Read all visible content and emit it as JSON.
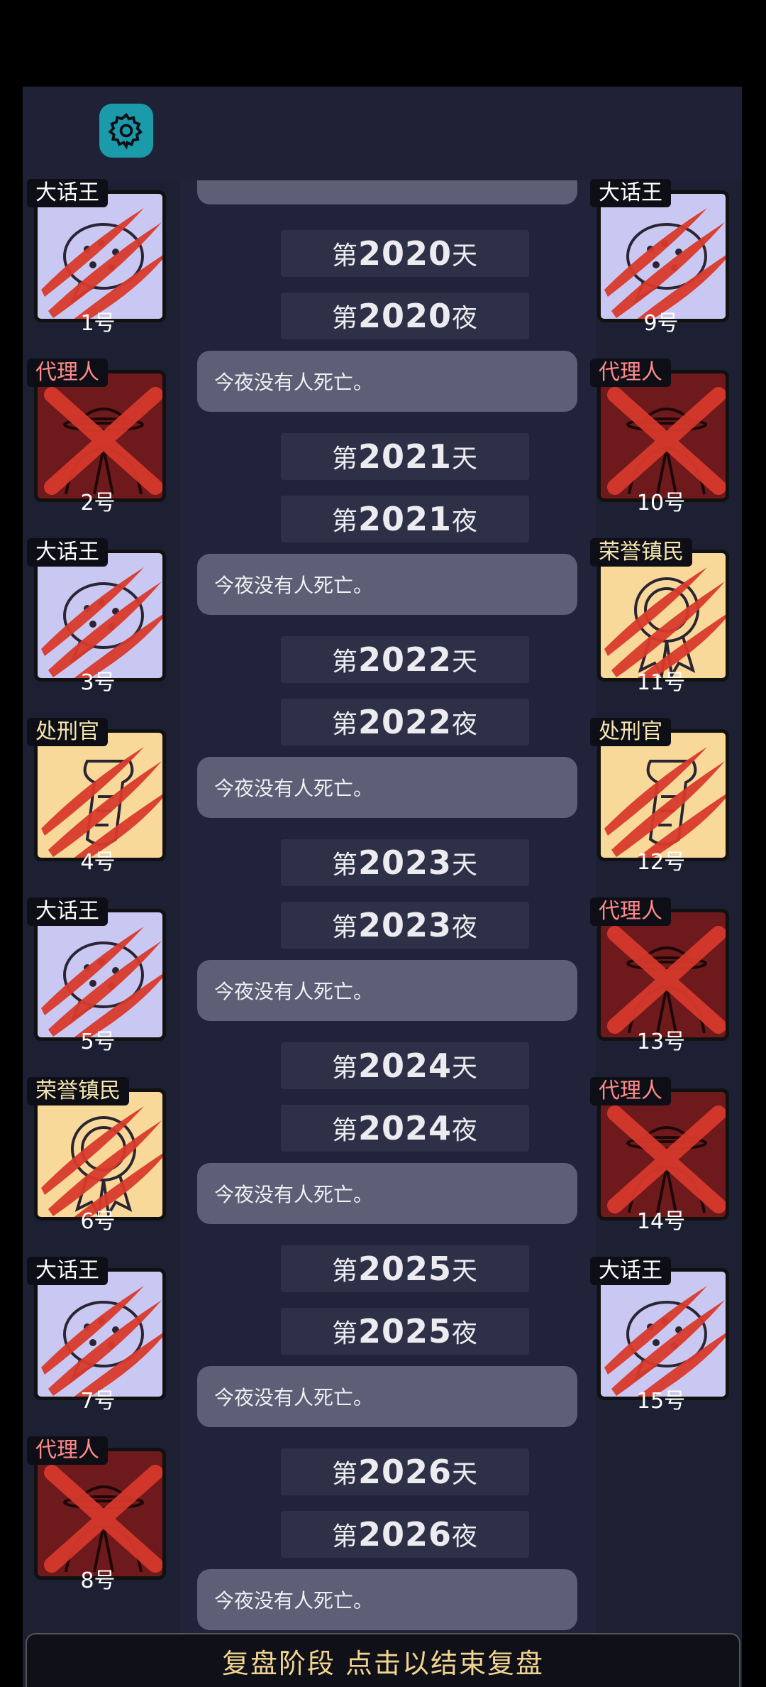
{
  "settings_icon": "gear-icon",
  "left_players": [
    {
      "number": "1号",
      "role": "大话王",
      "style": "lavender",
      "mark": "claw",
      "icon": "speech-bubble-icon"
    },
    {
      "number": "2号",
      "role": "代理人",
      "style": "crimson",
      "mark": "x",
      "icon": "agent-icon"
    },
    {
      "number": "3号",
      "role": "大话王",
      "style": "lavender",
      "mark": "claw",
      "icon": "speech-bubble-icon"
    },
    {
      "number": "4号",
      "role": "处刑官",
      "style": "cream",
      "mark": "claw",
      "icon": "scroll-icon"
    },
    {
      "number": "5号",
      "role": "大话王",
      "style": "lavender",
      "mark": "claw",
      "icon": "speech-bubble-icon"
    },
    {
      "number": "6号",
      "role": "荣誉镇民",
      "style": "cream",
      "mark": "claw",
      "icon": "medal-icon"
    },
    {
      "number": "7号",
      "role": "大话王",
      "style": "lavender",
      "mark": "claw",
      "icon": "speech-bubble-icon"
    },
    {
      "number": "8号",
      "role": "代理人",
      "style": "crimson",
      "mark": "x",
      "icon": "agent-icon"
    }
  ],
  "right_players": [
    {
      "number": "9号",
      "role": "大话王",
      "style": "lavender",
      "mark": "claw",
      "icon": "speech-bubble-icon"
    },
    {
      "number": "10号",
      "role": "代理人",
      "style": "crimson",
      "mark": "x",
      "icon": "agent-icon"
    },
    {
      "number": "11号",
      "role": "荣誉镇民",
      "style": "cream",
      "mark": "claw",
      "icon": "medal-icon"
    },
    {
      "number": "12号",
      "role": "处刑官",
      "style": "cream",
      "mark": "claw",
      "icon": "scroll-icon"
    },
    {
      "number": "13号",
      "role": "代理人",
      "style": "crimson",
      "mark": "x",
      "icon": "agent-icon"
    },
    {
      "number": "14号",
      "role": "代理人",
      "style": "crimson",
      "mark": "x",
      "icon": "agent-icon"
    },
    {
      "number": "15号",
      "role": "大话王",
      "style": "lavender",
      "mark": "claw",
      "icon": "speech-bubble-icon"
    }
  ],
  "log": [
    {
      "type": "day",
      "prefix": "第",
      "num": "2020",
      "suffix": "天"
    },
    {
      "type": "day",
      "prefix": "第",
      "num": "2020",
      "suffix": "夜"
    },
    {
      "type": "msg",
      "text": "今夜没有人死亡。"
    },
    {
      "type": "day",
      "prefix": "第",
      "num": "2021",
      "suffix": "天"
    },
    {
      "type": "day",
      "prefix": "第",
      "num": "2021",
      "suffix": "夜"
    },
    {
      "type": "msg",
      "text": "今夜没有人死亡。"
    },
    {
      "type": "day",
      "prefix": "第",
      "num": "2022",
      "suffix": "天"
    },
    {
      "type": "day",
      "prefix": "第",
      "num": "2022",
      "suffix": "夜"
    },
    {
      "type": "msg",
      "text": "今夜没有人死亡。"
    },
    {
      "type": "day",
      "prefix": "第",
      "num": "2023",
      "suffix": "天"
    },
    {
      "type": "day",
      "prefix": "第",
      "num": "2023",
      "suffix": "夜"
    },
    {
      "type": "msg",
      "text": "今夜没有人死亡。"
    },
    {
      "type": "day",
      "prefix": "第",
      "num": "2024",
      "suffix": "天"
    },
    {
      "type": "day",
      "prefix": "第",
      "num": "2024",
      "suffix": "夜"
    },
    {
      "type": "msg",
      "text": "今夜没有人死亡。"
    },
    {
      "type": "day",
      "prefix": "第",
      "num": "2025",
      "suffix": "天"
    },
    {
      "type": "day",
      "prefix": "第",
      "num": "2025",
      "suffix": "夜"
    },
    {
      "type": "msg",
      "text": "今夜没有人死亡。"
    },
    {
      "type": "day",
      "prefix": "第",
      "num": "2026",
      "suffix": "天"
    },
    {
      "type": "day",
      "prefix": "第",
      "num": "2026",
      "suffix": "夜"
    },
    {
      "type": "msg",
      "text": "今夜没有人死亡。"
    }
  ],
  "bottom_button": "复盘阶段 点击以结束复盘",
  "colors": {
    "lavender": "#c9c8f2",
    "cream": "#f8d99a",
    "crimson": "#6e1a1c",
    "role_tag_lavender": "#ffffff",
    "role_tag_cream": "#f6e6b0",
    "role_tag_crimson": "#ff8a8a",
    "accent": "#1b9aaa",
    "slash": "#d93a2c"
  }
}
